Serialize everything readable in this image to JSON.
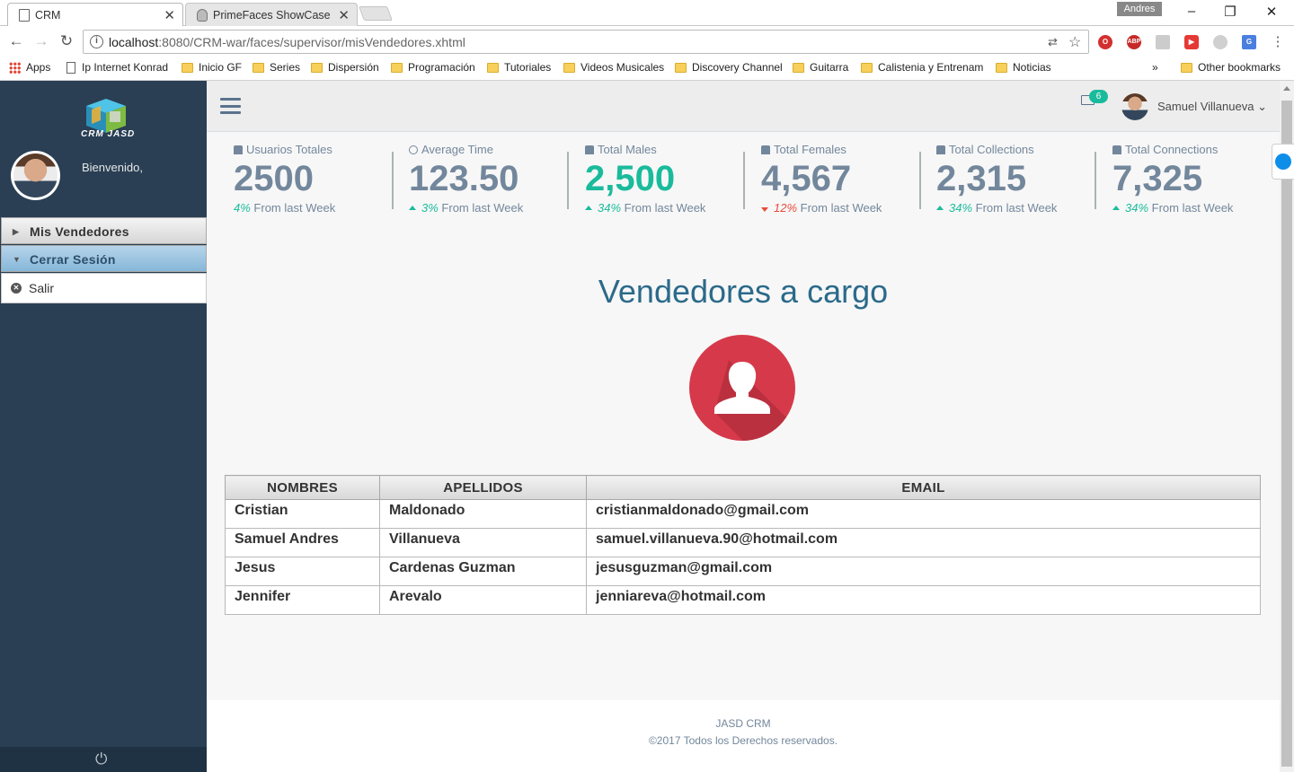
{
  "browser": {
    "tabs": [
      {
        "title": "CRM",
        "active": true
      },
      {
        "title": "PrimeFaces ShowCase",
        "active": false
      }
    ],
    "profile": "Andres",
    "url_host": "localhost",
    "url_path": ":8080/CRM-war/faces/supervisor/misVendedores.xhtml",
    "bookmarks": [
      {
        "label": "Apps",
        "icon": "apps-icon"
      },
      {
        "label": "Ip Internet Konrad",
        "icon": "page-icon"
      },
      {
        "label": "Inicio GF",
        "icon": "folder-icon"
      },
      {
        "label": "Series",
        "icon": "folder-icon"
      },
      {
        "label": "Dispersión",
        "icon": "folder-icon"
      },
      {
        "label": "Programación",
        "icon": "folder-icon"
      },
      {
        "label": "Tutoriales",
        "icon": "folder-icon"
      },
      {
        "label": "Videos Musicales",
        "icon": "folder-icon"
      },
      {
        "label": "Discovery Channel",
        "icon": "folder-icon"
      },
      {
        "label": "Guitarra",
        "icon": "folder-icon"
      },
      {
        "label": "Calistenia y Entrenam",
        "icon": "folder-icon"
      },
      {
        "label": "Noticias",
        "icon": "folder-icon"
      }
    ],
    "overflow": "»",
    "other_bookmarks": "Other bookmarks"
  },
  "sidebar": {
    "logo_text": "CRM JASD",
    "welcome": "Bienvenido,",
    "menu": [
      {
        "label": "Mis Vendedores",
        "expanded": false
      },
      {
        "label": "Cerrar Sesión",
        "expanded": true
      }
    ],
    "submenu_item": "Salir"
  },
  "topnav": {
    "notifications": "6",
    "user_name": "Samuel Villanueva"
  },
  "stats": [
    {
      "label": "Usuarios Totales",
      "icon": "user-icon",
      "value": "2500",
      "change": "4%",
      "trend": "none",
      "suffix": "From last Week",
      "highlight": false
    },
    {
      "label": "Average Time",
      "icon": "clock-icon",
      "value": "123.50",
      "change": "3%",
      "trend": "up",
      "suffix": "From last Week",
      "highlight": false
    },
    {
      "label": "Total Males",
      "icon": "user-icon",
      "value": "2,500",
      "change": "34%",
      "trend": "up",
      "suffix": "From last Week",
      "highlight": true
    },
    {
      "label": "Total Females",
      "icon": "user-icon",
      "value": "4,567",
      "change": "12%",
      "trend": "down",
      "suffix": "From last Week",
      "highlight": false
    },
    {
      "label": "Total Collections",
      "icon": "user-icon",
      "value": "2,315",
      "change": "34%",
      "trend": "up",
      "suffix": "From last Week",
      "highlight": false
    },
    {
      "label": "Total Connections",
      "icon": "user-icon",
      "value": "7,325",
      "change": "34%",
      "trend": "up",
      "suffix": "From last Week",
      "highlight": false
    }
  ],
  "main": {
    "heading": "Vendedores a cargo",
    "table": {
      "headers": [
        "NOMBRES",
        "APELLIDOS",
        "EMAIL"
      ],
      "rows": [
        [
          "Cristian",
          "Maldonado",
          "cristianmaldonado@gmail.com"
        ],
        [
          "Samuel Andres",
          "Villanueva",
          "samuel.villanueva.90@hotmail.com"
        ],
        [
          "Jesus",
          "Cardenas Guzman",
          "jesusguzman@gmail.com"
        ],
        [
          "Jennifer",
          "Arevalo",
          "jenniareva@hotmail.com"
        ]
      ]
    }
  },
  "footer": {
    "line1": "JASD CRM",
    "line2": "©2017 Todos los Derechos reservados."
  },
  "colors": {
    "sidebar": "#2a3f54",
    "accent_green": "#1abb9c",
    "accent_red": "#e74c3c",
    "heading": "#2b6a8a",
    "stat_text": "#73879c"
  }
}
